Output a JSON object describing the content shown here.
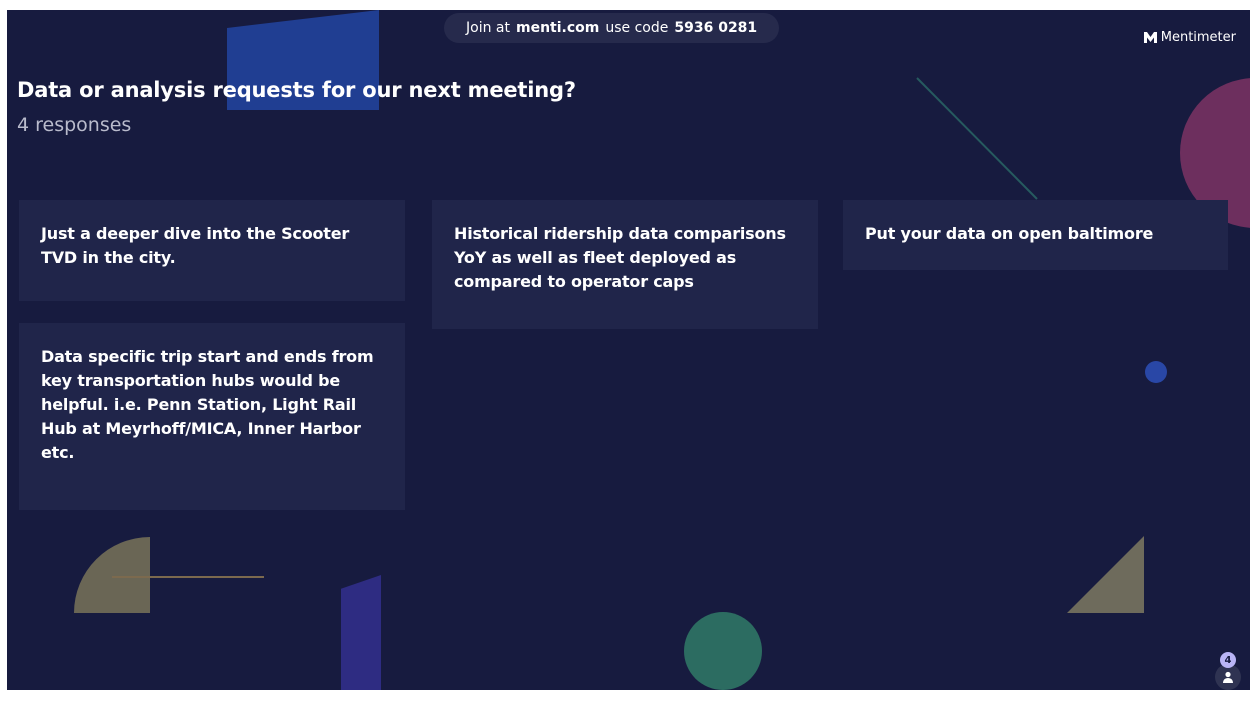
{
  "join_bar": {
    "prefix": "Join at",
    "site": "menti.com",
    "middle": "use code",
    "code": "5936 0281"
  },
  "brand": {
    "name": "Mentimeter",
    "icon": "mentimeter-logo-icon"
  },
  "question": {
    "title": "Data or analysis requests for our next meeting?",
    "responses_label": "4 responses"
  },
  "responses": [
    {
      "text": "Just a deeper dive into the Scooter TVD in the city."
    },
    {
      "text": "Historical ridership data comparisons YoY as well as fleet deployed as compared to operator caps"
    },
    {
      "text": "Put your data on open baltimore"
    },
    {
      "text": "Data specific trip start and ends from key transportation hubs would be helpful. i.e. Penn Station, Light Rail Hub at Meyrhoff/MICA, Inner Harbor etc."
    }
  ],
  "participants": {
    "count": "4",
    "icon": "person-icon"
  },
  "colors": {
    "background": "#171b3f",
    "card": "#20254a",
    "accent_blue": "#2f55c9",
    "accent_pink": "#7c3566",
    "accent_green": "#2c6e62",
    "accent_grey": "#777259"
  }
}
